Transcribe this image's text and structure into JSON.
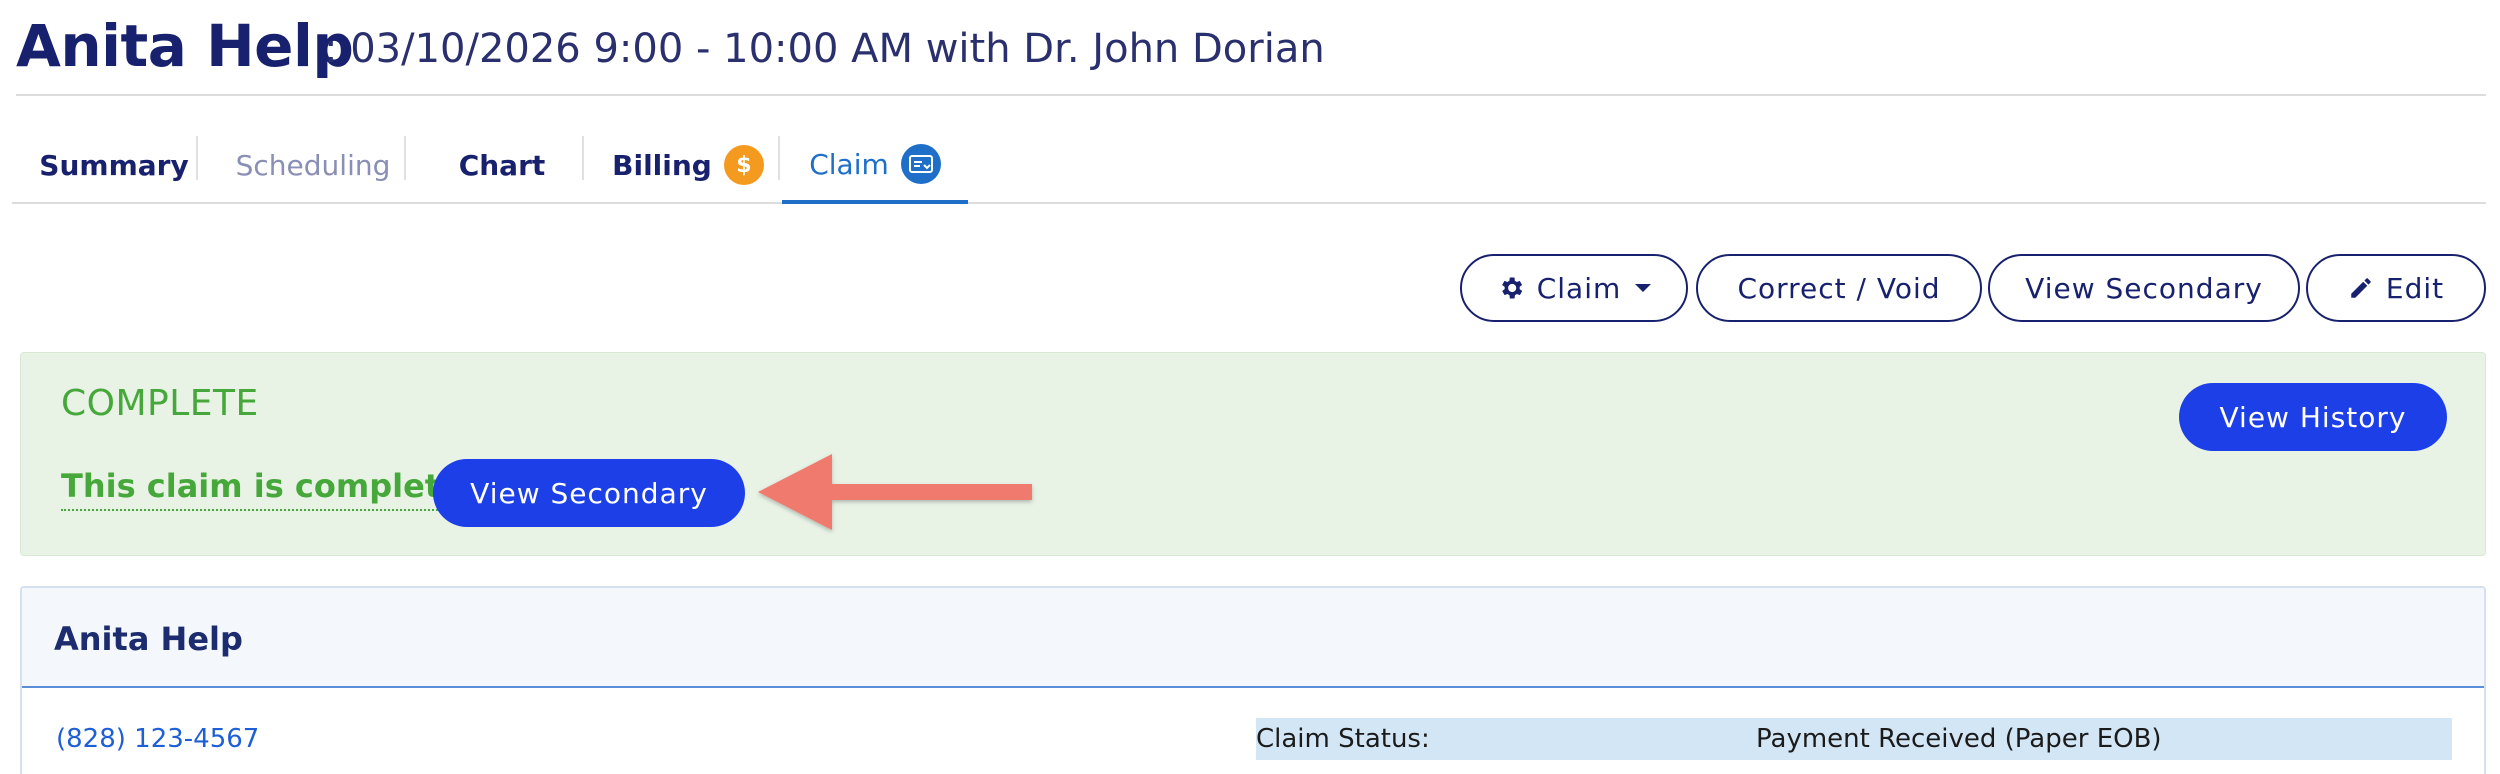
{
  "header": {
    "patient_name": "Anita Help",
    "appointment": ": 03/10/2026 9:00 - 10:00 AM with Dr. John Dorian"
  },
  "tabs": [
    {
      "label": "Summary",
      "state": "normal"
    },
    {
      "label": "Scheduling",
      "state": "disabled"
    },
    {
      "label": "Chart",
      "state": "normal"
    },
    {
      "label": "Billing",
      "state": "normal",
      "badge": "$"
    },
    {
      "label": "Claim",
      "state": "active",
      "badge": "claim-icon"
    }
  ],
  "actions": {
    "claim_label": "Claim",
    "correct_void_label": "Correct / Void",
    "view_secondary_label": "View Secondary",
    "edit_label": "Edit"
  },
  "banner": {
    "title": "COMPLETE",
    "message": "This claim is complete.",
    "view_secondary_label": "View Secondary",
    "view_history_label": "View History"
  },
  "card": {
    "title": "Anita Help",
    "phone": "(828) 123-4567",
    "status_label": "Claim Status:",
    "status_value": "Payment Received (Paper EOB)"
  },
  "colors": {
    "brand_navy": "#18216e",
    "accent_blue": "#1d3fe8",
    "success_green": "#46a83a",
    "billing_badge": "#f39a1f",
    "annotation_arrow": "#f07a6e"
  }
}
